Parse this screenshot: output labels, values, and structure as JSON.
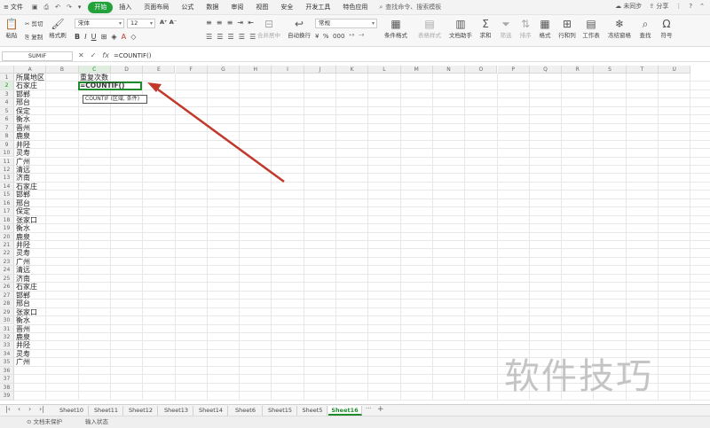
{
  "menubar": {
    "file_label": "文件",
    "tabs": [
      "开始",
      "插入",
      "页面布局",
      "公式",
      "数据",
      "审阅",
      "视图",
      "安全",
      "开发工具",
      "特色应用"
    ],
    "active_tab": "开始",
    "search": "查找命令、搜索模板",
    "sync": "未同步",
    "share": "分享"
  },
  "toolbar": {
    "paste": "粘贴",
    "cut": "剪切",
    "copy": "复制",
    "format_painter": "格式刷",
    "font_name": "宋体",
    "font_size": "12",
    "merge_center": "合并居中",
    "wrap": "自动换行",
    "number_format": "常规",
    "conditional_format": "条件格式",
    "table_style": "表格样式",
    "doc_helper": "文档助手",
    "sum": "求和",
    "filter": "筛选",
    "sort": "排序",
    "format": "格式",
    "row_col": "行和列",
    "worksheet": "工作表",
    "freeze": "冻结窗格",
    "find": "查找",
    "symbol": "符号"
  },
  "formula_bar": {
    "name_box": "SUMIF",
    "fx": "fx",
    "formula": "=COUNTIF()"
  },
  "grid": {
    "columns": [
      "A",
      "B",
      "C",
      "D",
      "E",
      "F",
      "G",
      "H",
      "I",
      "J",
      "K",
      "L",
      "M",
      "N",
      "O",
      "P",
      "Q",
      "R",
      "S",
      "T",
      "U"
    ],
    "rows": [
      "1",
      "2",
      "3",
      "4",
      "5",
      "6",
      "7",
      "8",
      "9",
      "10",
      "11",
      "12",
      "13",
      "14",
      "15",
      "16",
      "17",
      "18",
      "19",
      "20",
      "21",
      "22",
      "23",
      "24",
      "25",
      "26",
      "27",
      "28",
      "29",
      "30",
      "31",
      "32",
      "33",
      "34",
      "35",
      "36",
      "37",
      "38",
      "39"
    ],
    "column_a": [
      "所属地区",
      "石家庄",
      "邯郸",
      "邢台",
      "保定",
      "衡水",
      "晋州",
      "鹿泉",
      "井陉",
      "灵寿",
      "广州",
      "清远",
      "济南",
      "石家庄",
      "邯郸",
      "邢台",
      "保定",
      "张家口",
      "衡水",
      "鹿泉",
      "井陉",
      "灵寿",
      "广州",
      "清远",
      "济南",
      "石家庄",
      "邯郸",
      "邢台",
      "张家口",
      "衡水",
      "晋州",
      "鹿泉",
      "井陉",
      "灵寿",
      "广州"
    ],
    "c1": "重复次数",
    "active_cell_text": "=COUNTIF()",
    "tooltip": "COUNTIF (区域, 条件)"
  },
  "watermark": "软件技巧",
  "sheets": [
    "Sheet10",
    "Sheet11",
    "Sheet12",
    "Sheet13",
    "Sheet14",
    "Sheet6",
    "Sheet15",
    "Sheet5",
    "Sheet16"
  ],
  "active_sheet": "Sheet16",
  "status": {
    "protect": "文档未保护",
    "mode": "输入状态"
  },
  "colors": {
    "accent": "#23a23c",
    "arrow": "#c0392b"
  }
}
